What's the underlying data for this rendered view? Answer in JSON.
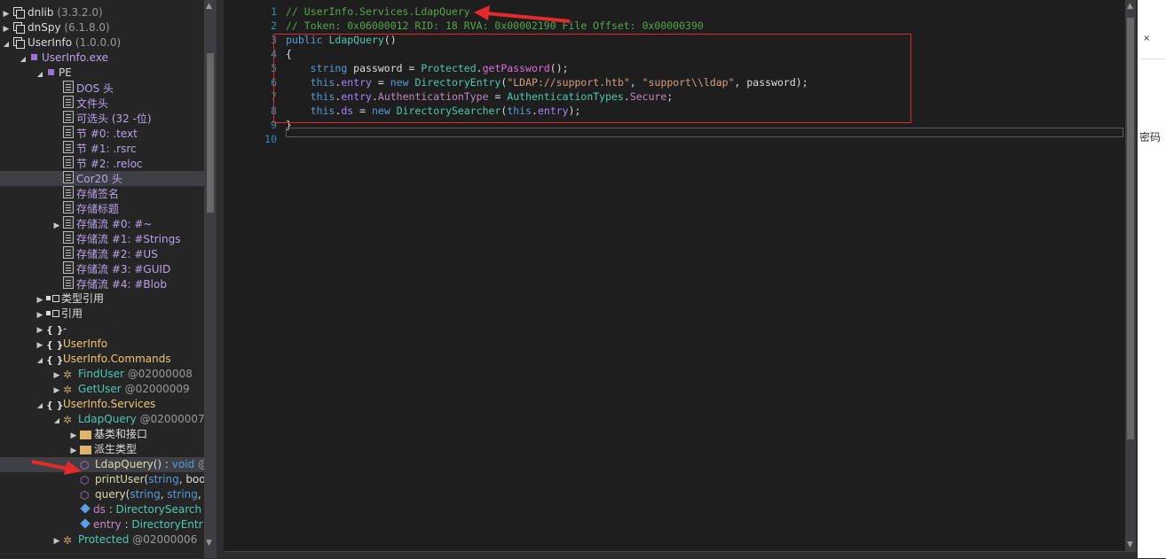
{
  "tree": {
    "items": [
      {
        "exp": "▶",
        "icon": "assembly-icon",
        "parts": [
          [
            "dnlib ",
            "t-white"
          ],
          [
            "(3.3.2.0)",
            "t-gray"
          ]
        ],
        "indent": 0
      },
      {
        "exp": "▶",
        "icon": "assembly-icon",
        "parts": [
          [
            "dnSpy ",
            "t-white"
          ],
          [
            "(6.1.8.0)",
            "t-gray"
          ]
        ],
        "indent": 0
      },
      {
        "exp": "◢",
        "icon": "assembly-icon",
        "parts": [
          [
            "UserInfo ",
            "t-white"
          ],
          [
            "(1.0.0.0)",
            "t-gray"
          ]
        ],
        "indent": 0
      },
      {
        "exp": "◢",
        "icon": "module-icon",
        "parts": [
          [
            "UserInfo.exe",
            "t-lav"
          ]
        ],
        "indent": 1
      },
      {
        "exp": "◢",
        "icon": "module-icon",
        "parts": [
          [
            "PE",
            "t-white"
          ]
        ],
        "indent": 2
      },
      {
        "exp": "",
        "icon": "document-icon",
        "parts": [
          [
            "DOS 头",
            "t-lav"
          ]
        ],
        "indent": 3
      },
      {
        "exp": "",
        "icon": "document-icon",
        "parts": [
          [
            "文件头",
            "t-lav"
          ]
        ],
        "indent": 3
      },
      {
        "exp": "",
        "icon": "document-icon",
        "parts": [
          [
            "可选头 (32 -位)",
            "t-lav"
          ]
        ],
        "indent": 3
      },
      {
        "exp": "",
        "icon": "document-icon",
        "parts": [
          [
            "节 #0: .text",
            "t-lav"
          ]
        ],
        "indent": 3
      },
      {
        "exp": "",
        "icon": "document-icon",
        "parts": [
          [
            "节 #1: .rsrc",
            "t-lav"
          ]
        ],
        "indent": 3
      },
      {
        "exp": "",
        "icon": "document-icon",
        "parts": [
          [
            "节 #2: .reloc",
            "t-lav"
          ]
        ],
        "indent": 3
      },
      {
        "exp": "",
        "icon": "document-icon",
        "parts": [
          [
            "Cor20 头",
            "t-lav"
          ]
        ],
        "indent": 3,
        "selected": true
      },
      {
        "exp": "",
        "icon": "document-icon",
        "parts": [
          [
            "存储签名",
            "t-lav"
          ]
        ],
        "indent": 3
      },
      {
        "exp": "",
        "icon": "document-icon",
        "parts": [
          [
            "存储标题",
            "t-lav"
          ]
        ],
        "indent": 3
      },
      {
        "exp": "▶",
        "icon": "document-icon",
        "parts": [
          [
            "存储流 #0: #~",
            "t-lav"
          ]
        ],
        "indent": 3
      },
      {
        "exp": "",
        "icon": "document-icon",
        "parts": [
          [
            "存储流 #1: #Strings",
            "t-lav"
          ]
        ],
        "indent": 3
      },
      {
        "exp": "",
        "icon": "document-icon",
        "parts": [
          [
            "存储流 #2: #US",
            "t-lav"
          ]
        ],
        "indent": 3
      },
      {
        "exp": "",
        "icon": "document-icon",
        "parts": [
          [
            "存储流 #3: #GUID",
            "t-lav"
          ]
        ],
        "indent": 3
      },
      {
        "exp": "",
        "icon": "document-icon",
        "parts": [
          [
            "存储流 #4: #Blob",
            "t-lav"
          ]
        ],
        "indent": 3
      },
      {
        "exp": "▶",
        "icon": "type-references-icon",
        "parts": [
          [
            "类型引用",
            "t-white"
          ]
        ],
        "indent": 2
      },
      {
        "exp": "▶",
        "icon": "references-icon",
        "parts": [
          [
            "引用",
            "t-white"
          ]
        ],
        "indent": 2
      },
      {
        "exp": "▶",
        "icon": "namespace-icon",
        "parts": [
          [
            "-",
            "t-white"
          ]
        ],
        "indent": 2
      },
      {
        "exp": "▶",
        "icon": "namespace-icon",
        "parts": [
          [
            "UserInfo",
            "t-ns"
          ]
        ],
        "indent": 2
      },
      {
        "exp": "◢",
        "icon": "namespace-icon",
        "parts": [
          [
            "UserInfo.Commands",
            "t-ns"
          ]
        ],
        "indent": 2
      },
      {
        "exp": "▶",
        "icon": "class-icon",
        "parts": [
          [
            "FindUser ",
            "t-type"
          ],
          [
            "@02000008",
            "t-gray"
          ]
        ],
        "indent": 3
      },
      {
        "exp": "▶",
        "icon": "class-icon",
        "parts": [
          [
            "GetUser ",
            "t-type"
          ],
          [
            "@02000009",
            "t-gray"
          ]
        ],
        "indent": 3
      },
      {
        "exp": "◢",
        "icon": "namespace-icon",
        "parts": [
          [
            "UserInfo.Services",
            "t-ns"
          ]
        ],
        "indent": 2
      },
      {
        "exp": "◢",
        "icon": "class-icon",
        "parts": [
          [
            "LdapQuery ",
            "t-type"
          ],
          [
            "@02000007",
            "t-gray"
          ]
        ],
        "indent": 3
      },
      {
        "exp": "▶",
        "icon": "folder-icon",
        "parts": [
          [
            "基类和接口",
            "t-white"
          ]
        ],
        "indent": 4
      },
      {
        "exp": "▶",
        "icon": "folder-icon",
        "parts": [
          [
            "派生类型",
            "t-white"
          ]
        ],
        "indent": 4
      },
      {
        "exp": "",
        "icon": "method-icon",
        "parts": [
          [
            "LdapQuery",
            "t-method"
          ],
          [
            "() : ",
            "t-white"
          ],
          [
            "void",
            "t-blue"
          ],
          [
            " @",
            "t-gray"
          ]
        ],
        "indent": 4,
        "selected": true
      },
      {
        "exp": "",
        "icon": "method-icon",
        "parts": [
          [
            "printUser",
            "t-method"
          ],
          [
            "(",
            "t-white"
          ],
          [
            "string",
            "t-blue"
          ],
          [
            ", boo",
            "t-white"
          ]
        ],
        "indent": 4
      },
      {
        "exp": "",
        "icon": "method-icon",
        "parts": [
          [
            "query",
            "t-method"
          ],
          [
            "(",
            "t-white"
          ],
          [
            "string",
            "t-blue"
          ],
          [
            ", ",
            "t-white"
          ],
          [
            "string",
            "t-blue"
          ],
          [
            ",",
            "t-white"
          ]
        ],
        "indent": 4
      },
      {
        "exp": "",
        "icon": "field-icon",
        "parts": [
          [
            "ds",
            "t-purple"
          ],
          [
            " : ",
            "t-white"
          ],
          [
            "DirectorySearch",
            "t-type"
          ]
        ],
        "indent": 4
      },
      {
        "exp": "",
        "icon": "field-icon",
        "parts": [
          [
            "entry",
            "t-purple"
          ],
          [
            " : ",
            "t-white"
          ],
          [
            "DirectoryEntr",
            "t-type"
          ]
        ],
        "indent": 4
      },
      {
        "exp": "▶",
        "icon": "class-icon",
        "parts": [
          [
            "Protected ",
            "t-type"
          ],
          [
            "@02000006",
            "t-gray"
          ]
        ],
        "indent": 3
      }
    ]
  },
  "editor": {
    "line_numbers": [
      "1",
      "2",
      "3",
      "4",
      "5",
      "6",
      "7",
      "8",
      "9",
      "10"
    ],
    "lines": [
      [
        [
          "// UserInfo.Services.LdapQuery",
          "c-comment"
        ]
      ],
      [
        [
          "// Token: 0x06000012 RID: 18 RVA: 0x00002190 File Offset: 0x00000390",
          "c-comment"
        ]
      ],
      [
        [
          "public ",
          "c-kw"
        ],
        [
          "LdapQuery",
          "c-type"
        ],
        [
          "()",
          "c-plain"
        ]
      ],
      [
        [
          "{",
          "c-plain"
        ]
      ],
      [
        [
          "    ",
          "c-plain"
        ],
        [
          "string ",
          "c-kw"
        ],
        [
          "password = ",
          "c-plain"
        ],
        [
          "Protected",
          "c-type"
        ],
        [
          ".",
          "c-plain"
        ],
        [
          "getPassword",
          "c-method"
        ],
        [
          "();",
          "c-plain"
        ]
      ],
      [
        [
          "    ",
          "c-plain"
        ],
        [
          "this",
          "c-kw"
        ],
        [
          ".",
          "c-plain"
        ],
        [
          "entry",
          "c-field"
        ],
        [
          " = ",
          "c-plain"
        ],
        [
          "new ",
          "c-kw"
        ],
        [
          "DirectoryEntry",
          "c-type"
        ],
        [
          "(",
          "c-plain"
        ],
        [
          "\"LDAP://support.htb\"",
          "c-str"
        ],
        [
          ", ",
          "c-plain"
        ],
        [
          "\"support\\\\ldap\"",
          "c-str"
        ],
        [
          ", password);",
          "c-plain"
        ]
      ],
      [
        [
          "    ",
          "c-plain"
        ],
        [
          "this",
          "c-kw"
        ],
        [
          ".",
          "c-plain"
        ],
        [
          "entry",
          "c-field"
        ],
        [
          ".",
          "c-plain"
        ],
        [
          "AuthenticationType",
          "c-prop"
        ],
        [
          " = ",
          "c-plain"
        ],
        [
          "AuthenticationTypes",
          "c-type"
        ],
        [
          ".",
          "c-plain"
        ],
        [
          "Secure",
          "c-prop"
        ],
        [
          ";",
          "c-plain"
        ]
      ],
      [
        [
          "    ",
          "c-plain"
        ],
        [
          "this",
          "c-kw"
        ],
        [
          ".",
          "c-plain"
        ],
        [
          "ds",
          "c-field"
        ],
        [
          " = ",
          "c-plain"
        ],
        [
          "new ",
          "c-kw"
        ],
        [
          "DirectorySearcher",
          "c-type"
        ],
        [
          "(",
          "c-plain"
        ],
        [
          "this",
          "c-kw"
        ],
        [
          ".",
          "c-plain"
        ],
        [
          "entry",
          "c-field"
        ],
        [
          ");",
          "c-plain"
        ]
      ],
      [
        [
          "}",
          "c-plain"
        ]
      ],
      [
        [
          "",
          "c-plain"
        ]
      ]
    ]
  },
  "right_panel": {
    "fragment": "密码",
    "close_glyph": "×"
  },
  "colors": {
    "highlight_box": "#e0292b",
    "annotation_arrow": "#e32b2b"
  }
}
